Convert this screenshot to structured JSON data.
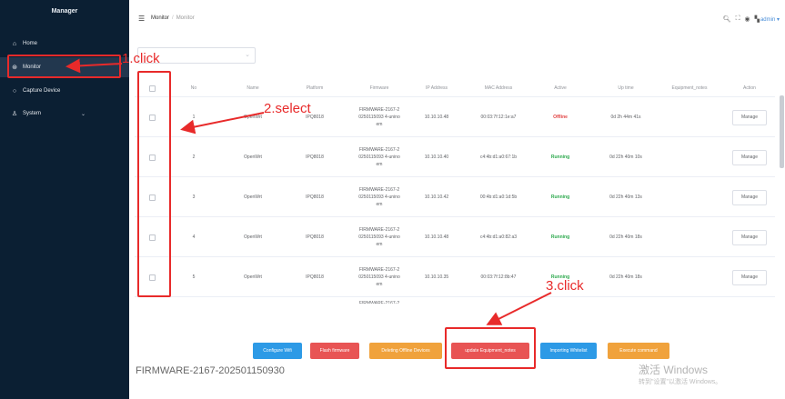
{
  "sidebar": {
    "title": "Manager",
    "items": [
      {
        "label": "Home",
        "icon": "home-icon",
        "glyph": "⌂"
      },
      {
        "label": "Monitor",
        "icon": "monitor-icon",
        "glyph": "⊛"
      },
      {
        "label": "Capture Device",
        "icon": "search-icon",
        "glyph": "○"
      },
      {
        "label": "System",
        "icon": "user-icon",
        "glyph": "♙"
      }
    ]
  },
  "header": {
    "breadcrumb": [
      "Monitor",
      "Monitor"
    ],
    "user": "admin"
  },
  "table": {
    "columns": [
      "No",
      "Name",
      "Platform",
      "Firmware",
      "IP Address",
      "MAC Address",
      "Active",
      "Up time",
      "Equipment_notes",
      "Action"
    ],
    "rows": [
      {
        "no": "1",
        "name": "OpenWrt",
        "platform": "IPQ8018",
        "fw1": "FIRMWARE-2167-2",
        "fw2": "0250115093 4-unino",
        "fw3": "em",
        "ip": "10.10.10.48",
        "mac": "00:03:7f:12:1e:a7",
        "active": "Offline",
        "uptime": "0d 2h 44m 41s",
        "notes": "",
        "action": "Manage"
      },
      {
        "no": "2",
        "name": "OpenWrt",
        "platform": "IPQ8018",
        "fw1": "FIRMWARE-2167-2",
        "fw2": "0250115093 4-unino",
        "fw3": "em",
        "ip": "10.10.10.40",
        "mac": "c4:4b:d1:a0:67:1b",
        "active": "Running",
        "uptime": "0d 22h 40m 10s",
        "notes": "",
        "action": "Manage"
      },
      {
        "no": "3",
        "name": "OpenWrt",
        "platform": "IPQ8018",
        "fw1": "FIRMWARE-2167-2",
        "fw2": "0250115093 4-unino",
        "fw3": "em",
        "ip": "10.10.10.42",
        "mac": "00:4b:d1:a0:1d:5b",
        "active": "Running",
        "uptime": "0d 22h 40m 13s",
        "notes": "",
        "action": "Manage"
      },
      {
        "no": "4",
        "name": "OpenWrt",
        "platform": "IPQ8018",
        "fw1": "FIRMWARE-2167-2",
        "fw2": "0250115093 4-unino",
        "fw3": "em",
        "ip": "10.10.10.48",
        "mac": "c4:4b:d1:a0:82:a3",
        "active": "Running",
        "uptime": "0d 22h 40m 18s",
        "notes": "",
        "action": "Manage"
      },
      {
        "no": "5",
        "name": "OpenWrt",
        "platform": "IPQ8018",
        "fw1": "FIRMWARE-2167-2",
        "fw2": "0250115093 4-unino",
        "fw3": "em",
        "ip": "10.10.10.35",
        "mac": "00:03:7f:12:8b:47",
        "active": "Running",
        "uptime": "0d 22h 40m 18s",
        "notes": "",
        "action": "Manage"
      },
      {
        "no": "",
        "name": "",
        "platform": "",
        "fw1": "FIRMWARE-2167-2",
        "fw2": "",
        "fw3": "",
        "ip": "",
        "mac": "",
        "active": "",
        "uptime": "",
        "notes": "",
        "action": ""
      }
    ]
  },
  "actions": [
    {
      "label": "Configure Wifi",
      "color": "#2d9ae6"
    },
    {
      "label": "Flash firmware",
      "color": "#e85454"
    },
    {
      "label": "Deleting Offline Devices",
      "color": "#f0a23c"
    },
    {
      "label": "update Equipment_notes",
      "color": "#e85454"
    },
    {
      "label": "Importing Whitelist",
      "color": "#2d9ae6"
    },
    {
      "label": "Execute command",
      "color": "#f0a23c"
    }
  ],
  "firmware_label": "FIRMWARE-2167-202501150930",
  "watermark": {
    "line1": "激活 Windows",
    "line2": "转到\"设置\"以激活 Windows。"
  },
  "annotations": {
    "step1": "1.click",
    "step2": "2.select",
    "step3": "3.click"
  },
  "colors": {
    "sidebar_bg": "#0b1f33",
    "annotation_red": "#e82a2a",
    "running": "#2eaa4e",
    "offline": "#e24444"
  }
}
